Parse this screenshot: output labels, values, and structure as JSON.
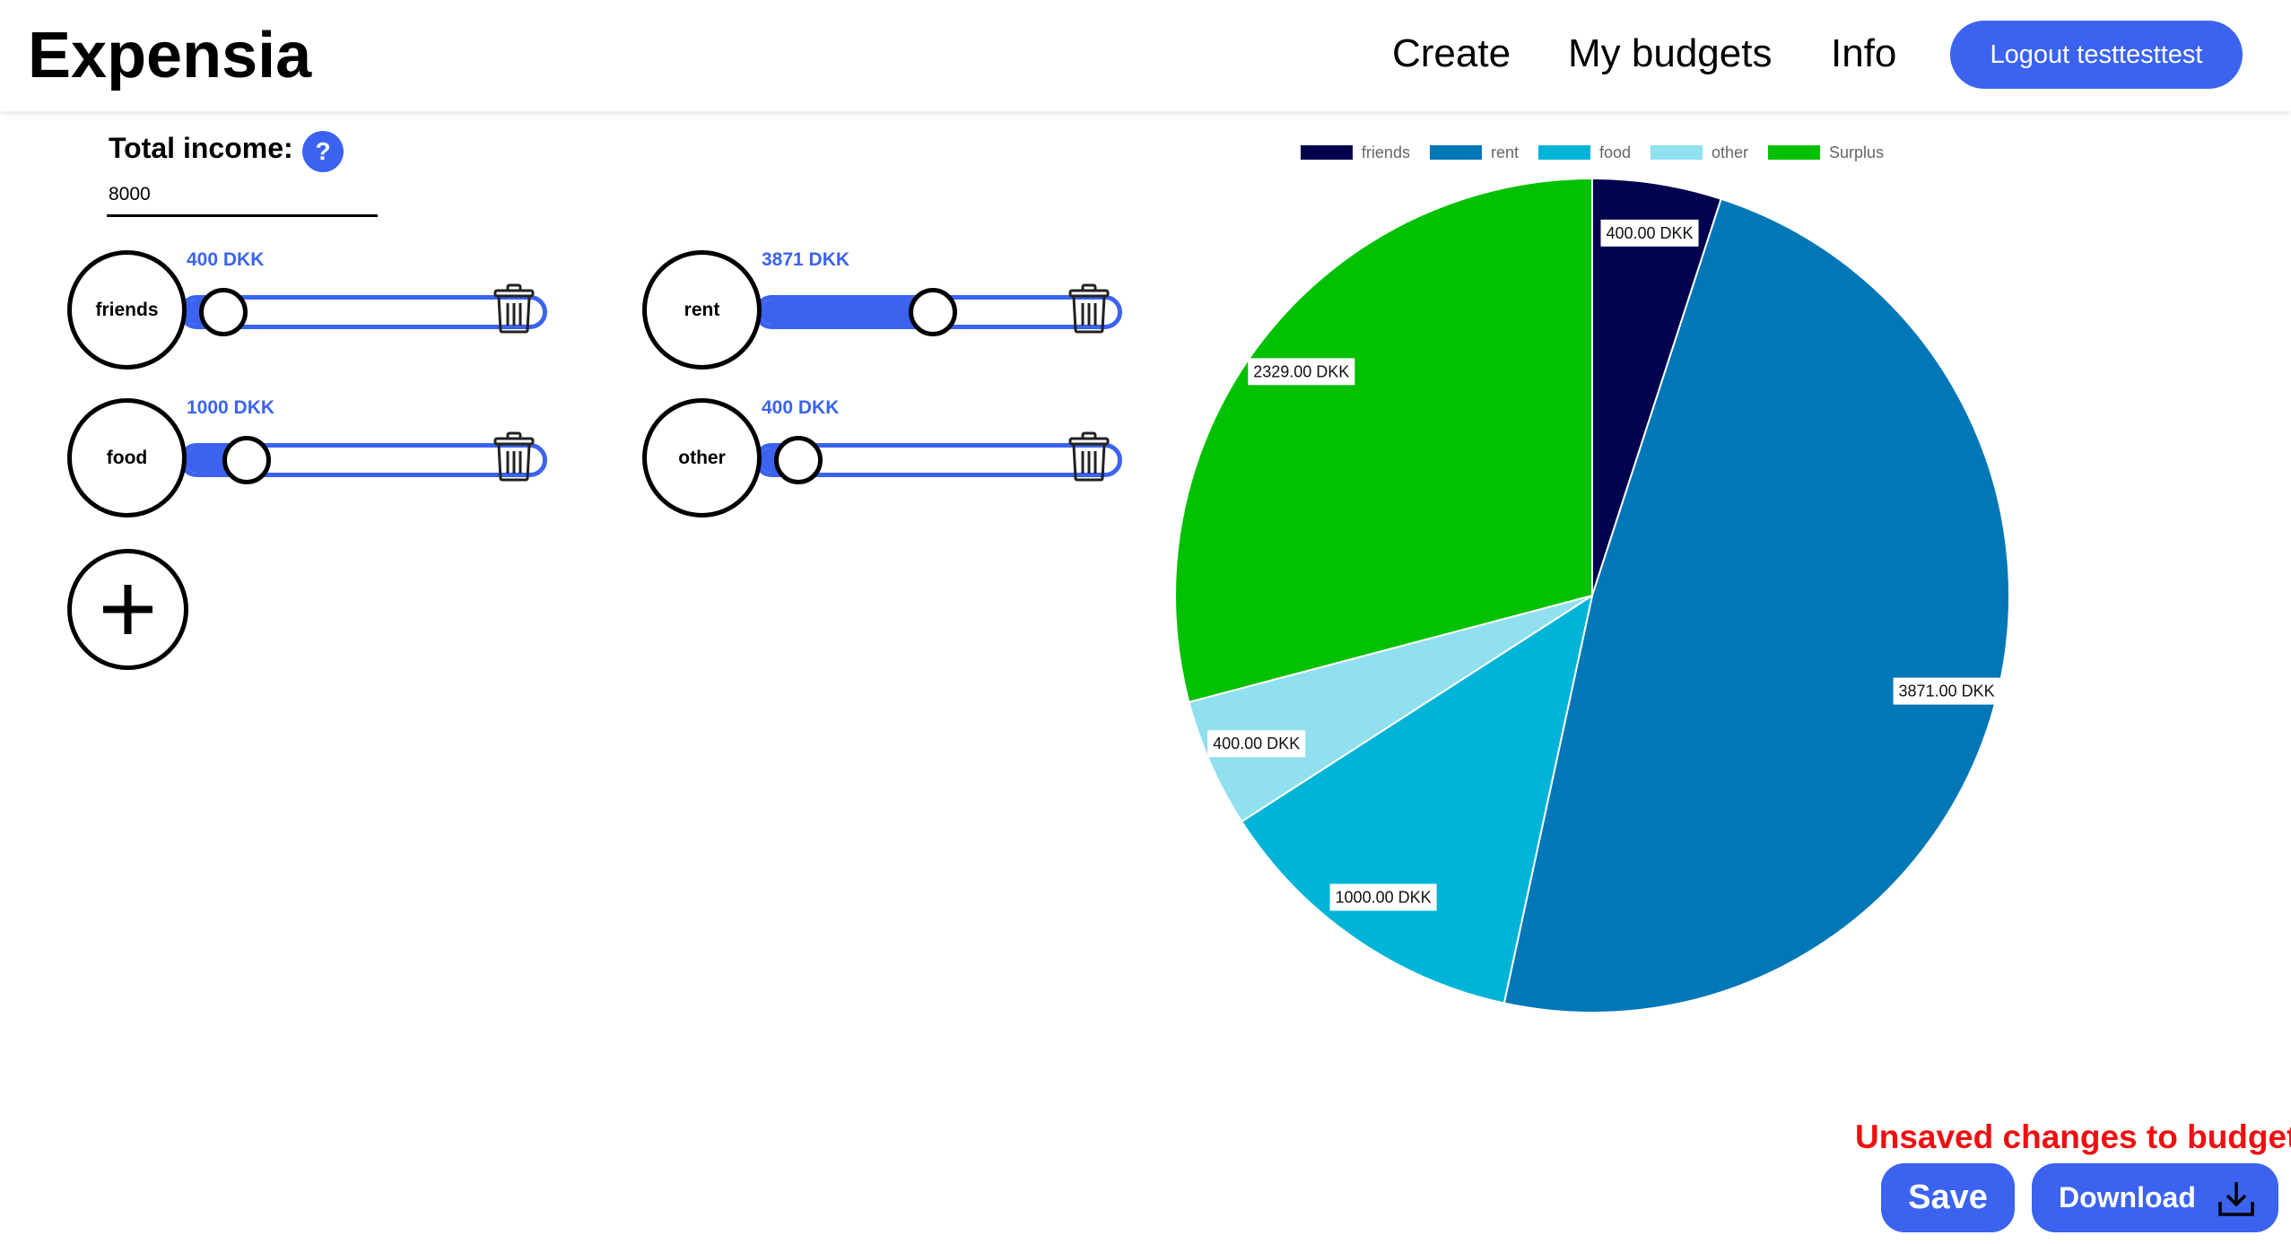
{
  "header": {
    "brand": "Expensia",
    "nav": {
      "create": "Create",
      "my_budgets": "My budgets",
      "info": "Info"
    },
    "logout_label": "Logout testtesttest"
  },
  "income": {
    "label": "Total income:",
    "help_label": "?",
    "value": "8000"
  },
  "categories": [
    {
      "name": "friends",
      "amount_label": "400 DKK",
      "value": 400
    },
    {
      "name": "rent",
      "amount_label": "3871 DKK",
      "value": 3871
    },
    {
      "name": "food",
      "amount_label": "1000 DKK",
      "value": 1000
    },
    {
      "name": "other",
      "amount_label": "400 DKK",
      "value": 400
    }
  ],
  "slider_max": 8000,
  "add_label": "+",
  "icons": {
    "help": "question-icon",
    "trash": "trash-icon",
    "add": "plus-icon",
    "download": "download-icon"
  },
  "colors": {
    "accent": "#3b63f0",
    "warning": "#ee1010"
  },
  "chart_data": {
    "type": "pie",
    "categories": [
      "friends",
      "rent",
      "food",
      "other",
      "Surplus"
    ],
    "values": [
      400,
      3871,
      1000,
      400,
      2329
    ],
    "data_labels": [
      "400.00 DKK",
      "3871.00 DKK",
      "1000.00 DKK",
      "400.00 DKK",
      "2329.00 DKK"
    ],
    "colors": [
      "#03024f",
      "#0077b6",
      "#00b4d8",
      "#90e0ef",
      "#02c102"
    ],
    "legend_position": "top",
    "start_angle": "top, clockwise"
  },
  "footer": {
    "unsaved_message": "Unsaved changes to budget!",
    "save_label": "Save",
    "download_label": "Download"
  }
}
